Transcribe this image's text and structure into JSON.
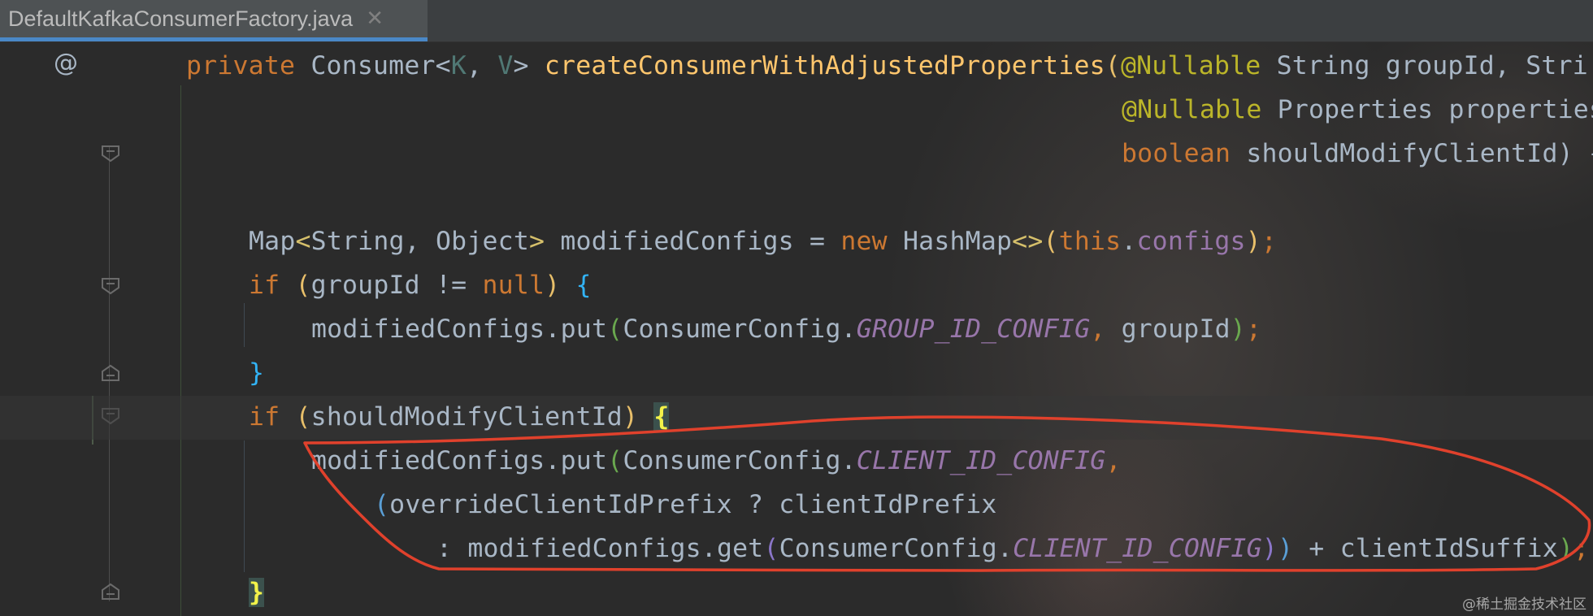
{
  "tab": {
    "filename": "DefaultKafkaConsumerFactory.java",
    "close_icon": "close-icon"
  },
  "gutter": {
    "annotation_mark": "@"
  },
  "code": {
    "line1": {
      "t1": "private ",
      "t2": "Consumer",
      "t3": "<",
      "t4": "K",
      "t5": ", ",
      "t6": "V",
      "t7": "> ",
      "t8": "createConsumerWithAdjustedProperties",
      "t9": "(",
      "t10": "@Nullable",
      "t11": " String groupId, Stri"
    },
    "line2": {
      "t1": "@Nullable",
      "t2": " Properties properties"
    },
    "line3": {
      "t1": "boolean",
      "t2": " shouldModifyClientId) {"
    },
    "line5": {
      "t1": "Map",
      "t2": "<",
      "t3": "String",
      "t4": ", ",
      "t5": "Object",
      "t6": "> ",
      "t7": "modifiedConfigs = ",
      "t8": "new ",
      "t9": "HashMap",
      "t10": "<>",
      "t11": "(",
      "t12": "this",
      "t13": ".",
      "t14": "configs",
      "t15": ")",
      "t16": ";"
    },
    "line6": {
      "t1": "if ",
      "t2": "(",
      "t3": "groupId != ",
      "t4": "null",
      "t5": ")",
      "t6": " ",
      "t7": "{"
    },
    "line7": {
      "t1": "modifiedConfigs.put",
      "t2": "(",
      "t3": "ConsumerConfig.",
      "t4": "GROUP_ID_CONFIG",
      "t5": ", ",
      "t6": "groupId",
      "t7": ")",
      "t8": ";"
    },
    "line8": {
      "t1": "}"
    },
    "line9": {
      "t1": "if ",
      "t2": "(",
      "t3": "shouldModifyClientId",
      "t4": ")",
      "t5": " ",
      "t6": "{"
    },
    "line10": {
      "t1": "modifiedConfigs.put",
      "t2": "(",
      "t3": "ConsumerConfig.",
      "t4": "CLIENT_ID_CONFIG",
      "t5": ","
    },
    "line11": {
      "t1": "(",
      "t2": "overrideClientIdPrefix ? clientIdPrefix"
    },
    "line12": {
      "t1": ": modifiedConfigs.get",
      "t2": "(",
      "t3": "ConsumerConfig.",
      "t4": "CLIENT_ID_CONFIG",
      "t5": ")",
      "t6": ")",
      "t7": " + clientIdSuffix",
      "t8": ")",
      "t9": ";"
    },
    "line13": {
      "t1": "}"
    }
  },
  "watermark": "@稀土掘金技术社区",
  "colors": {
    "background": "#2b2b2b",
    "keyword": "#cc7832",
    "method": "#ffc66d",
    "annotation": "#bbb529",
    "constant": "#9876aa",
    "tab_underline": "#4a88c7",
    "red_annotation": "#e0412c"
  }
}
